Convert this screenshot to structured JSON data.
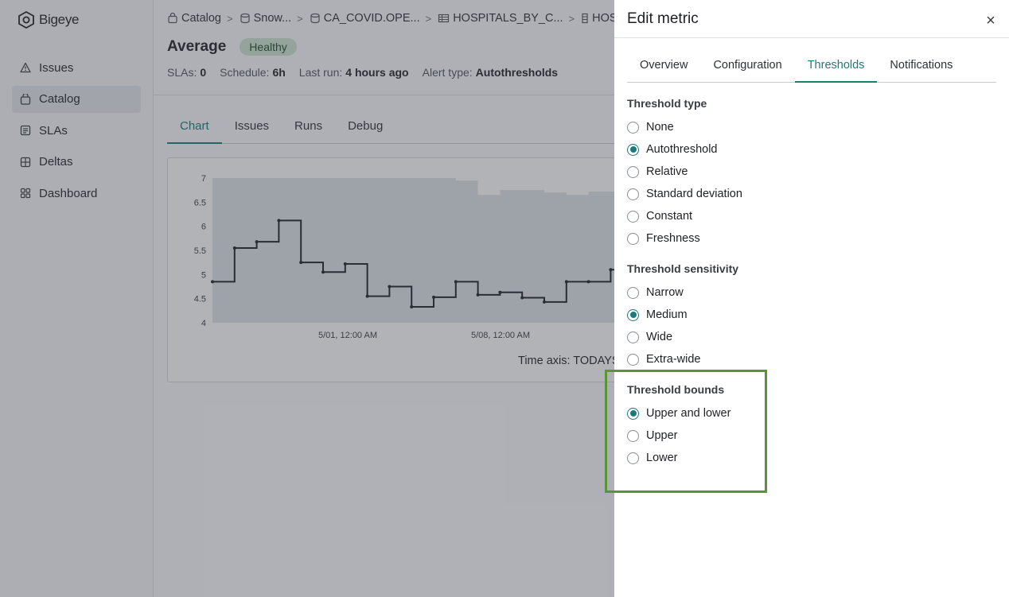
{
  "app": {
    "brand": "Bigeye",
    "nav": [
      {
        "label": "Issues",
        "icon": "warning-icon",
        "active": false
      },
      {
        "label": "Catalog",
        "icon": "database-icon",
        "active": true
      },
      {
        "label": "SLAs",
        "icon": "document-icon",
        "active": false
      },
      {
        "label": "Deltas",
        "icon": "deltas-icon",
        "active": false
      },
      {
        "label": "Dashboard",
        "icon": "dashboard-icon",
        "active": false
      }
    ]
  },
  "breadcrumb": [
    {
      "label": "Catalog",
      "icon": "catalog-icon"
    },
    {
      "label": "Snow...",
      "icon": "warehouse-icon"
    },
    {
      "label": "CA_COVID.OPE...",
      "icon": "schema-icon"
    },
    {
      "label": "HOSPITALS_BY_C...",
      "icon": "table-icon"
    },
    {
      "label": "HOSP",
      "icon": "column-icon"
    }
  ],
  "metric": {
    "title": "Average",
    "status": "Healthy",
    "meta": [
      {
        "label": "SLAs:",
        "value": "0"
      },
      {
        "label": "Schedule:",
        "value": "6h"
      },
      {
        "label": "Last run:",
        "value": "4 hours ago"
      },
      {
        "label": "Alert type:",
        "value": "Autothresholds"
      }
    ],
    "tabs": [
      "Chart",
      "Issues",
      "Runs",
      "Debug"
    ],
    "active_tab": "Chart"
  },
  "chart_data": {
    "type": "line",
    "title": "",
    "xlabel": "Time axis: TODAYS_",
    "ylabel": "",
    "y_ticks": [
      "7",
      "6.5",
      "6",
      "5.5",
      "5",
      "4.5",
      "4"
    ],
    "x_ticks": [
      "5/01, 12:00 AM",
      "5/08, 12:00 AM"
    ],
    "ylim": [
      4,
      7
    ],
    "series": [
      {
        "style": "step",
        "values": [
          4.85,
          5.55,
          5.68,
          6.12,
          5.25,
          5.05,
          5.22,
          4.55,
          4.75,
          4.33,
          4.53,
          4.85,
          4.58,
          4.63,
          4.52,
          4.43,
          4.85,
          4.85,
          5.1
        ]
      },
      {
        "style": "band-upper",
        "values": [
          7.0,
          7.0,
          7.0,
          7.0,
          7.0,
          7.0,
          7.0,
          7.0,
          7.0,
          7.0,
          7.0,
          6.95,
          6.65,
          6.75,
          6.75,
          6.7,
          6.65,
          6.72,
          6.72,
          6.85
        ]
      }
    ]
  },
  "drawer": {
    "title": "Edit metric",
    "close_label": "×",
    "tabs": [
      "Overview",
      "Configuration",
      "Thresholds",
      "Notifications"
    ],
    "active_tab": "Thresholds",
    "threshold_type": {
      "label": "Threshold type",
      "options": [
        "None",
        "Autothreshold",
        "Relative",
        "Standard deviation",
        "Constant",
        "Freshness"
      ],
      "selected": "Autothreshold"
    },
    "threshold_sensitivity": {
      "label": "Threshold sensitivity",
      "options": [
        "Narrow",
        "Medium",
        "Wide",
        "Extra-wide"
      ],
      "selected": "Medium"
    },
    "threshold_bounds": {
      "label": "Threshold bounds",
      "options": [
        "Upper and lower",
        "Upper",
        "Lower"
      ],
      "selected": "Upper and lower"
    }
  },
  "colors": {
    "accent": "#1c7a79",
    "highlight": "#5b9437",
    "badge_bg": "#cfe6d2"
  }
}
